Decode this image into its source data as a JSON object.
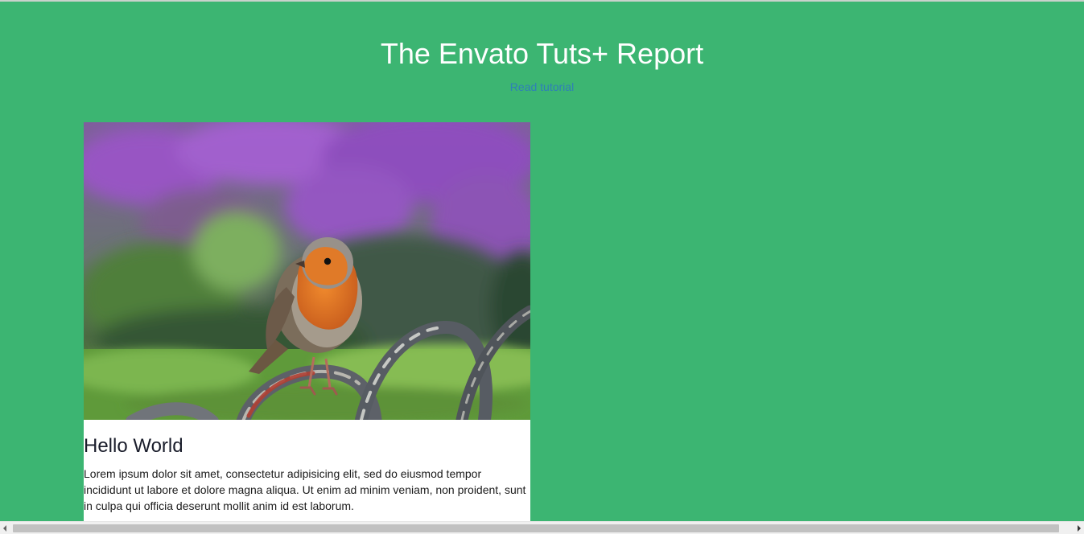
{
  "header": {
    "title": "The Envato Tuts+ Report",
    "link_text": "Read tutorial"
  },
  "card": {
    "image_subject": "robin perched on a curved metal railing in front of purple flowers",
    "title": "Hello World",
    "text": "Lorem ipsum dolor sit amet, consectetur adipisicing elit, sed do eiusmod tempor incididunt ut labore et dolore magna aliqua. Ut enim ad minim veniam, non proident, sunt in culpa qui officia deserunt mollit anim id est laborum."
  },
  "colors": {
    "page_background": "#3cb572",
    "title_text": "#ffffff",
    "link": "#2f7fb8",
    "card_background": "#ffffff"
  },
  "icons": {
    "scroll_left": "scroll-left-arrow-icon",
    "scroll_right": "scroll-right-arrow-icon"
  }
}
